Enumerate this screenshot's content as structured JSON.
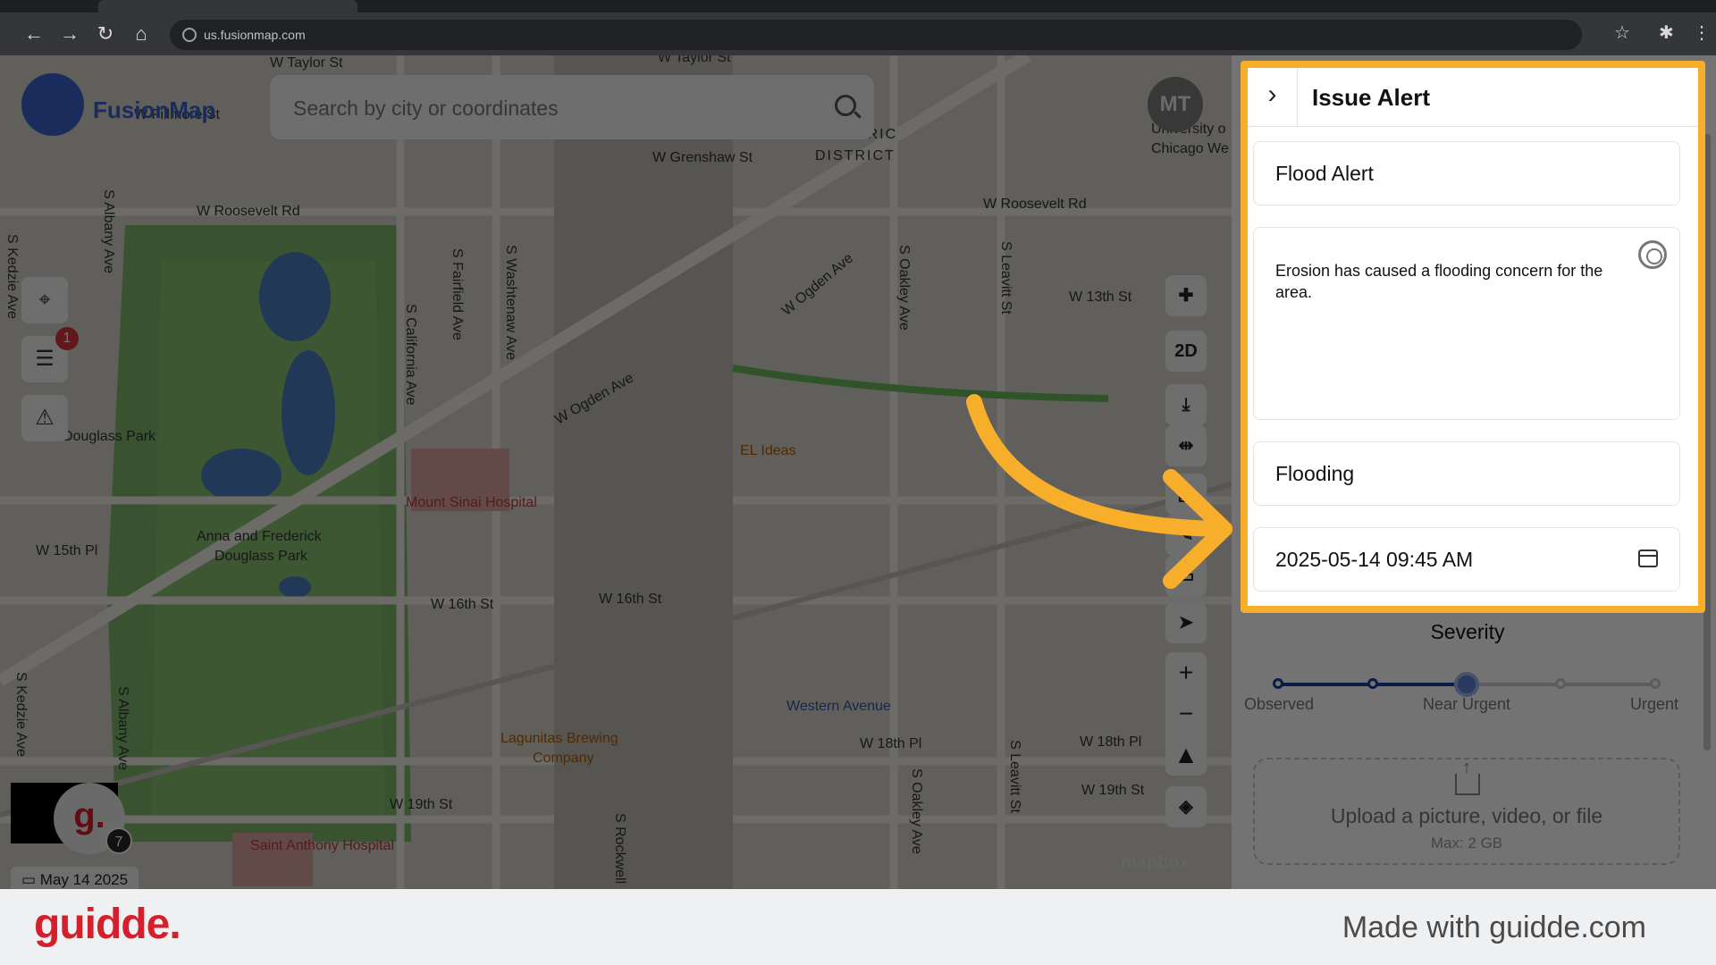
{
  "browser": {
    "url": "us.fusionmap.com"
  },
  "map": {
    "brand": "FusionMap",
    "search_placeholder": "Search by city or coordinates",
    "avatar_initials": "MT",
    "notification_count": "1",
    "view_mode": "2D",
    "date": "May 14 2025",
    "guidde_count": "7",
    "attribution": "mapbox",
    "labels": {
      "w_taylor_1": "W Taylor St",
      "w_taylor_2": "W Taylor St",
      "w_fillmore": "W Fillmore St",
      "w_grenshaw": "W Grenshaw St",
      "w_roosevelt_1": "W Roosevelt Rd",
      "w_roosevelt_2": "W Roosevelt Rd",
      "w_13th": "W 13th St",
      "w_ogden_1": "W Ogden Ave",
      "w_ogden_2": "W Ogden Ave",
      "el_ideas": "EL Ideas",
      "mount_sinai": "Mount Sinai Hospital",
      "w_15th": "W 15th Pl",
      "w_16th_1": "W 16th St",
      "w_16th_2": "W 16th St",
      "douglass_park": "Douglass Park",
      "anna_frederick": "Anna and Frederick",
      "douglass_park_2": "Douglass Park",
      "western_ave": "Western Avenue",
      "w_18th_pl": "W 18th Pl",
      "w_18th_pl_2": "W 18th Pl",
      "w_19th_1": "W 19th St",
      "w_19th_2": "W 19th St",
      "lagunitas": "Lagunitas Brewing",
      "company": "Company",
      "saint_anthony": "Saint Anthony Hospital",
      "historic": "HISTORIC",
      "district": "DISTRICT",
      "univ_1": "University o",
      "univ_2": "Chicago We",
      "s_kedzie_1": "S Kedzie Ave",
      "s_kedzie_2": "S Kedzie Ave",
      "s_albany_1": "S Albany Ave",
      "s_albany_2": "S Albany Ave",
      "s_california": "S California Ave",
      "s_fairfield": "S Fairfield Ave",
      "s_washtenaw": "S Washtenaw Ave",
      "s_oakley_1": "S Oakley Ave",
      "s_oakley_2": "S Oakley Ave",
      "s_leavitt_1": "S Leavitt St",
      "s_leavitt_2": "S Leavitt St",
      "s_rockwell": "S Rockwell"
    }
  },
  "panel": {
    "title": "Issue Alert",
    "alert_name": "Flood Alert",
    "description": "Erosion has caused a flooding concern for the area.",
    "category": "Flooding",
    "datetime": "2025-05-14 09:45  AM",
    "severity": {
      "label": "Severity",
      "levels": [
        "Observed",
        "Near Urgent",
        "Urgent"
      ],
      "selected_fraction": 0.5
    },
    "upload": {
      "text": "Upload a picture, video, or file",
      "max": "Max: 2 GB"
    }
  },
  "footer": {
    "logo": "guidde.",
    "text": "Made with guidde.com"
  },
  "colors": {
    "highlight": "#f7ae2b",
    "brand_red": "#d61f2c",
    "slider": "#1c3c9a"
  }
}
